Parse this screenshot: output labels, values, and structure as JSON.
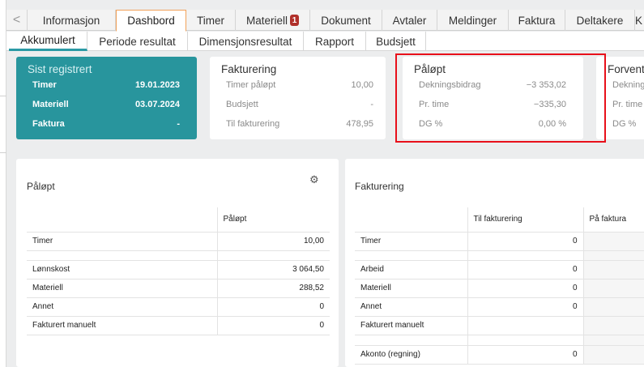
{
  "tabs": {
    "nav_prev": "<",
    "items": [
      {
        "label": "Informasjon"
      },
      {
        "label": "Dashbord"
      },
      {
        "label": "Timer"
      },
      {
        "label": "Materiell",
        "badge": "1"
      },
      {
        "label": "Dokument"
      },
      {
        "label": "Avtaler"
      },
      {
        "label": "Meldinger"
      },
      {
        "label": "Faktura"
      },
      {
        "label": "Deltakere"
      },
      {
        "label": "K"
      }
    ]
  },
  "subtabs": [
    "Akkumulert",
    "Periode resultat",
    "Dimensjonsresultat",
    "Rapport",
    "Budsjett"
  ],
  "cards": {
    "sist": {
      "title": "Sist registrert",
      "rows": [
        {
          "label": "Timer",
          "value": "19.01.2023"
        },
        {
          "label": "Materiell",
          "value": "03.07.2024"
        },
        {
          "label": "Faktura",
          "value": "-"
        }
      ]
    },
    "fakturering": {
      "title": "Fakturering",
      "rows": [
        {
          "label": "Timer påløpt",
          "value": "10,00"
        },
        {
          "label": "Budsjett",
          "value": "-"
        },
        {
          "label": "Til fakturering",
          "value": "478,95"
        }
      ]
    },
    "palopt": {
      "title": "Påløpt",
      "rows": [
        {
          "label": "Dekningsbidrag",
          "value": "−3 353,02"
        },
        {
          "label": "Pr. time",
          "value": "−335,30"
        },
        {
          "label": "DG %",
          "value": "0,00 %"
        }
      ]
    },
    "forventet": {
      "title": "Forvent",
      "rows": [
        {
          "label": "Dekning"
        },
        {
          "label": "Pr. time"
        },
        {
          "label": "DG %"
        }
      ]
    }
  },
  "palopt_panel": {
    "title": "Påløpt",
    "column": "Påløpt",
    "rows": [
      {
        "label": "Timer",
        "value": "10,00"
      },
      {
        "label": "Lønnskost",
        "value": "3 064,50"
      },
      {
        "label": "Materiell",
        "value": "288,52"
      },
      {
        "label": "Annet",
        "value": "0"
      },
      {
        "label": "Fakturert manuelt",
        "value": "0"
      }
    ]
  },
  "fakturering_panel": {
    "title": "Fakturering",
    "columns": [
      "Til fakturering",
      "På faktura"
    ],
    "rows": [
      {
        "label": "Timer",
        "value": "0"
      },
      {
        "label": "Arbeid",
        "value": "0"
      },
      {
        "label": "Materiell",
        "value": "0"
      },
      {
        "label": "Annet",
        "value": "0"
      },
      {
        "label": "Fakturert manuelt",
        "value": ""
      },
      {
        "label": "Akonto (regning)",
        "value": "0"
      }
    ]
  }
}
